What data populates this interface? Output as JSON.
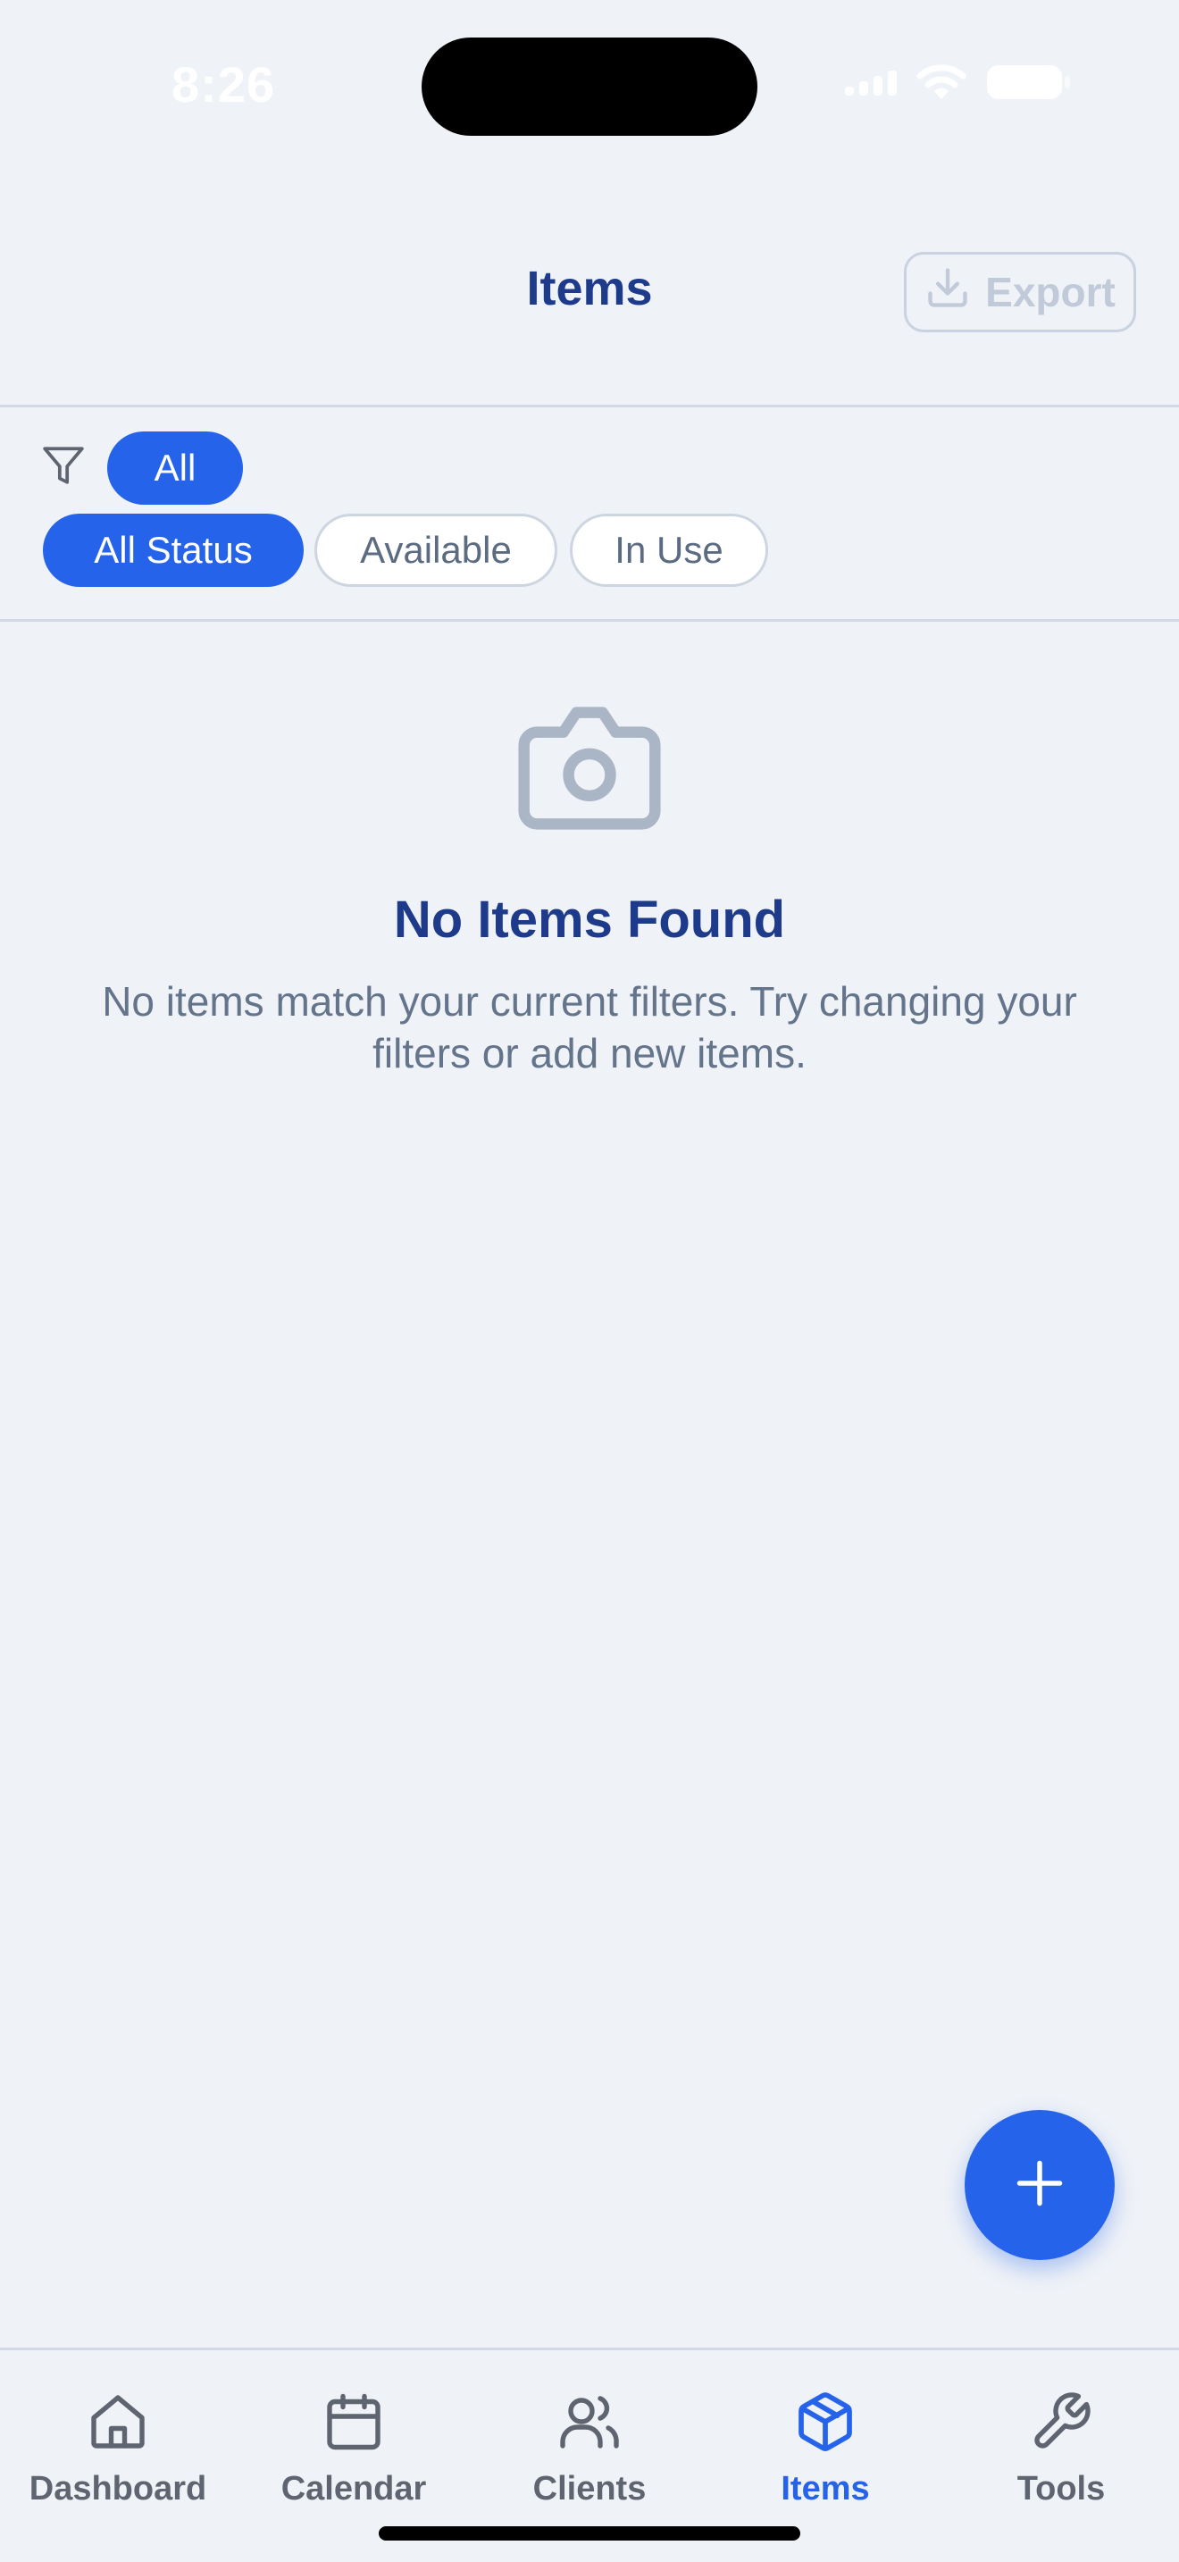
{
  "status_bar": {
    "time": "8:26"
  },
  "header": {
    "title": "Items",
    "export_label": "Export"
  },
  "filters": {
    "category_chips": [
      "All"
    ],
    "status_chips": [
      "All Status",
      "Available",
      "In Use"
    ],
    "selected_category": "All",
    "selected_status": "All Status"
  },
  "empty_state": {
    "title": "No Items Found",
    "message": "No items match your current filters. Try changing your filters or add new items."
  },
  "tab_bar": {
    "tabs": [
      {
        "label": "Dashboard",
        "icon": "home-icon"
      },
      {
        "label": "Calendar",
        "icon": "calendar-icon"
      },
      {
        "label": "Clients",
        "icon": "users-icon"
      },
      {
        "label": "Items",
        "icon": "box-icon"
      },
      {
        "label": "Tools",
        "icon": "wrench-icon"
      }
    ],
    "active": "Items"
  },
  "colors": {
    "accent": "#2563eb",
    "title": "#1e3a8a",
    "background": "#eff2f7",
    "muted_text": "#64748b"
  }
}
